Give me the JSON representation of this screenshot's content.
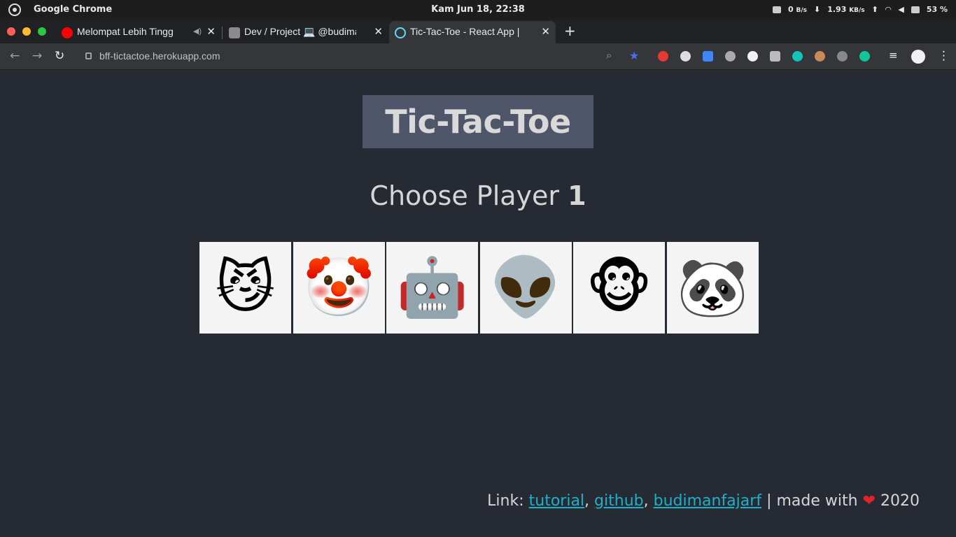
{
  "os": {
    "app_name": "Google Chrome",
    "clock": "Kam Jun 18, 22:38",
    "net_down": "0",
    "net_down_unit": "B/s",
    "net_up": "1.93",
    "net_up_unit": "KB/s",
    "battery": "53 %"
  },
  "tabs": [
    {
      "title": "Melompat Lebih Tingg",
      "favicon_color": "#ff0000",
      "active": false
    },
    {
      "title": "Dev / Project 💻 @budima",
      "favicon_color": "#888888",
      "active": false
    },
    {
      "title": "Tic-Tac-Toe - React App | b",
      "favicon_color": "#61dafb",
      "active": true
    }
  ],
  "toolbar": {
    "url": "bff-tictactoe.herokuapp.com"
  },
  "app": {
    "title": "Tic-Tac-Toe",
    "choose_text": "Choose Player",
    "player_number": "1",
    "players": [
      {
        "emoji": "😼",
        "icon": "smirking-cat-icon"
      },
      {
        "emoji": "🤡",
        "icon": "clown-icon"
      },
      {
        "emoji": "🤖",
        "icon": "robot-icon"
      },
      {
        "emoji": "👽",
        "icon": "alien-icon"
      },
      {
        "emoji": "🐵",
        "icon": "monkey-icon"
      },
      {
        "emoji": "🐼",
        "icon": "panda-icon"
      }
    ],
    "footer": {
      "prefix": "Link:",
      "link_tutorial": "tutorial",
      "link_github": "github",
      "link_author": "budimanfajarf",
      "made_with": "| made with",
      "heart": "❤",
      "year": "2020"
    }
  },
  "colors": {
    "page_bg": "#262a33",
    "title_bg": "#505669",
    "link": "#1eb0c9",
    "heart": "#e0242a"
  }
}
